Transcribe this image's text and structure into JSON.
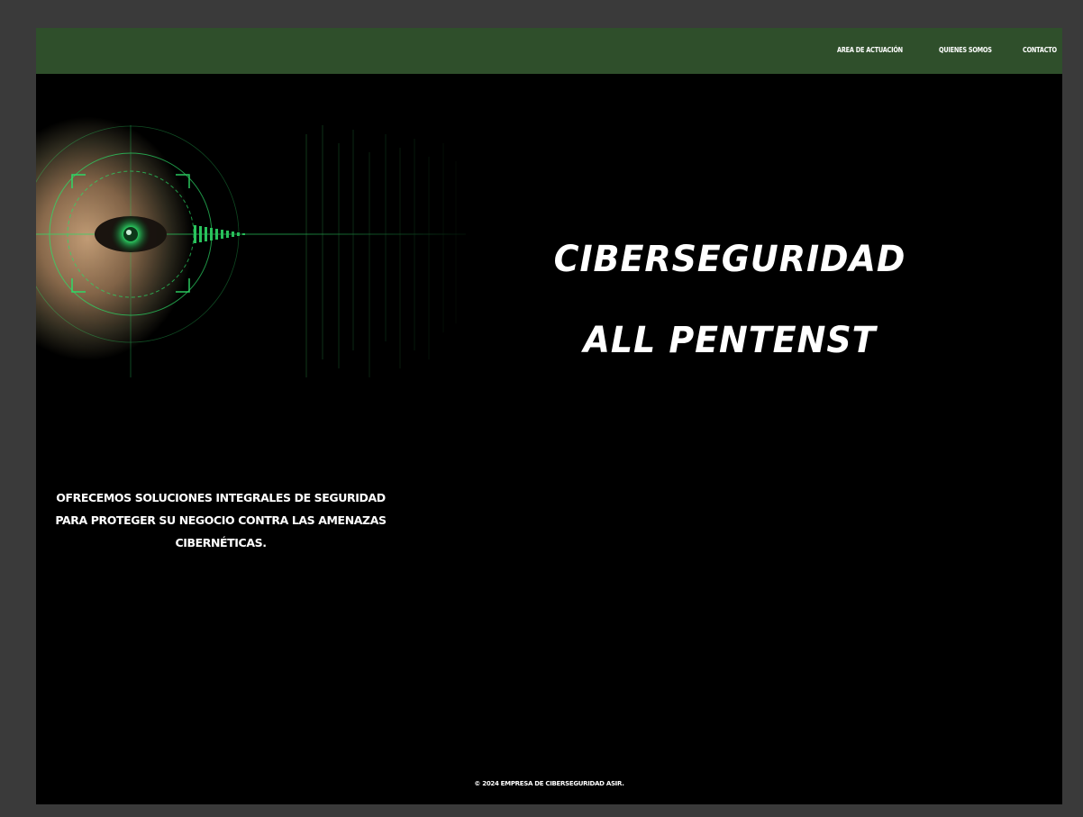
{
  "nav": {
    "items": [
      {
        "label": "AREA DE ACTUACIÓN"
      },
      {
        "label": "QUIENES SOMOS"
      },
      {
        "label": "CONTACTO"
      }
    ],
    "background": "#2f4f2b"
  },
  "hero": {
    "title_line1": "CIBERSEGURIDAD",
    "title_line2": "ALL PENTENST",
    "image_icon": "cyber-eye-scan-image"
  },
  "description": "OFRECEMOS SOLUCIONES INTEGRALES DE SEGURIDAD PARA PROTEGER SU NEGOCIO CONTRA LAS AMENAZAS CIBERNÉTICAS.",
  "footer": {
    "text": "© 2024 EMPRESA DE CIBERSEGURIDAD ASIR."
  },
  "colors": {
    "page_background": "#000000",
    "accent_green": "#2fe06a",
    "outer_background": "#3a3a3a"
  }
}
